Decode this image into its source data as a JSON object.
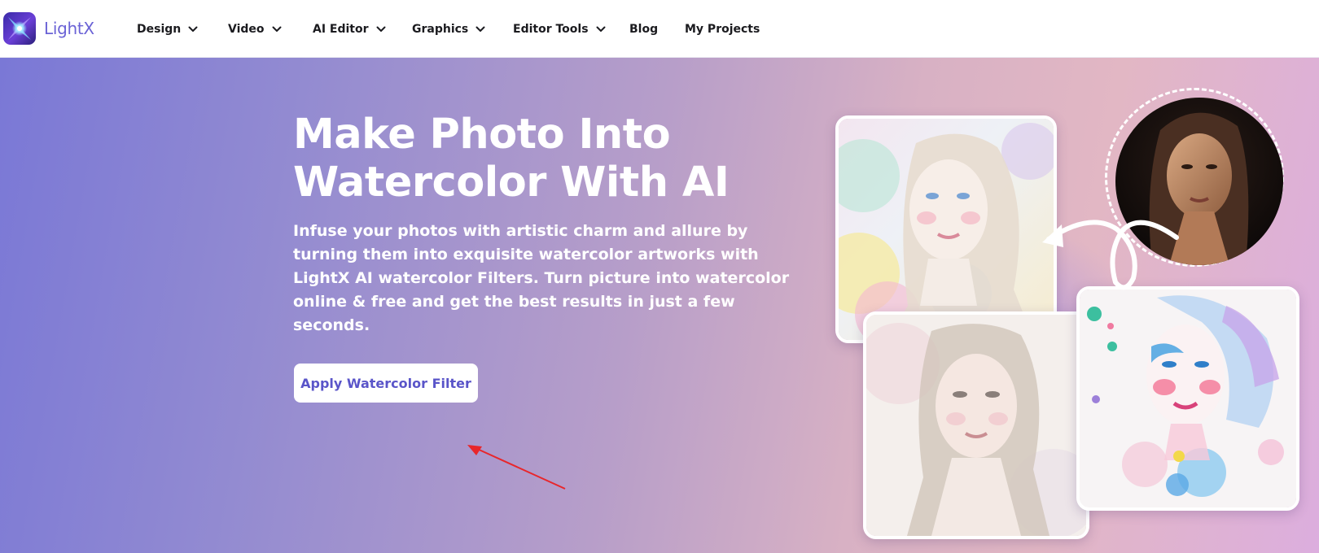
{
  "brand": {
    "name": "LightX"
  },
  "nav": {
    "items": [
      {
        "label": "Design",
        "has_dropdown": true
      },
      {
        "label": "Video",
        "has_dropdown": true
      },
      {
        "label": "AI Editor",
        "has_dropdown": true
      },
      {
        "label": "Graphics",
        "has_dropdown": true
      },
      {
        "label": "Editor Tools",
        "has_dropdown": true
      },
      {
        "label": "Blog",
        "has_dropdown": false
      },
      {
        "label": "My Projects",
        "has_dropdown": false
      }
    ]
  },
  "hero": {
    "title_line1": "Make Photo Into",
    "title_line2": "Watercolor With AI",
    "description": "Infuse your photos with artistic charm and allure by turning them into exquisite watercolor artworks with LightX AI watercolor Filters. Turn picture into watercolor online & free and get the best results in just a few seconds.",
    "cta_label": "Apply Watercolor Filter"
  },
  "images": {
    "original_portrait": "woman-portrait-photo",
    "card_1": "watercolor-portrait-pastel",
    "card_2": "watercolor-portrait-soft",
    "card_3": "watercolor-portrait-splash"
  },
  "colors": {
    "brand_purple": "#6b63d6",
    "cta_text": "#5a55c9",
    "annotation_arrow": "#e8262b",
    "hero_gradient_start": "#7a78d6",
    "hero_gradient_end": "#dcaede"
  }
}
